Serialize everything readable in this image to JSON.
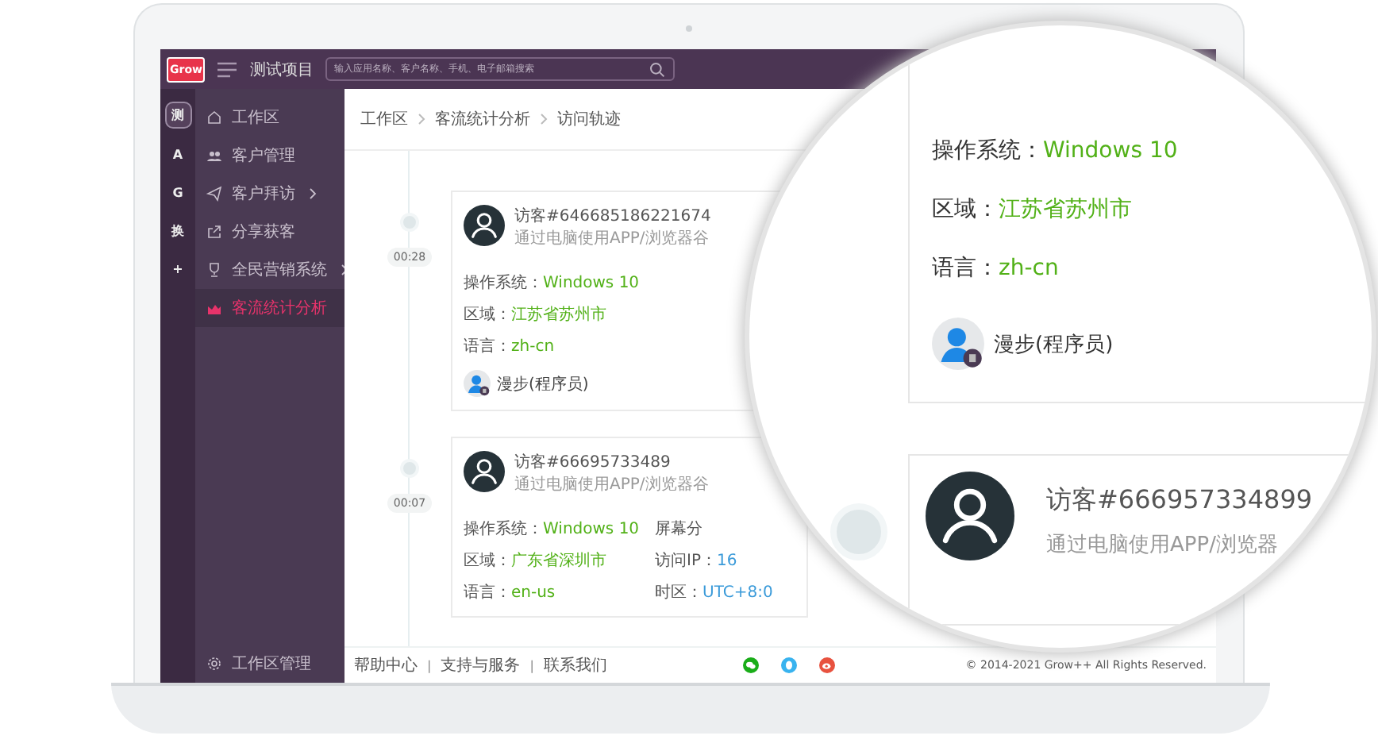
{
  "app": {
    "logo": "Grow",
    "title": "测试项目",
    "search": {
      "placeholder": "输入应用名称、客户名称、手机、电子邮箱搜索"
    }
  },
  "rail": [
    {
      "label": "测",
      "selected": true
    },
    {
      "label": "A",
      "selected": false
    },
    {
      "label": "G",
      "selected": false
    },
    {
      "label": "换",
      "selected": false
    },
    {
      "label": "+",
      "selected": false
    }
  ],
  "nav": [
    {
      "label": "工作区",
      "expandable": false,
      "selected": false
    },
    {
      "label": "客户管理",
      "expandable": false,
      "selected": false
    },
    {
      "label": "客户拜访",
      "expandable": true,
      "selected": false
    },
    {
      "label": "分享获客",
      "expandable": false,
      "selected": false
    },
    {
      "label": "全民营销系统",
      "expandable": true,
      "selected": false
    },
    {
      "label": "客流统计分析",
      "expandable": false,
      "selected": true
    }
  ],
  "nav_footer": {
    "label": "工作区管理"
  },
  "breadcrumb": [
    "工作区",
    "客流统计分析",
    "访问轨迹"
  ],
  "visits": [
    {
      "time": "00:28",
      "title": "访客#646685186221674",
      "subtitle": "通过电脑使用APP/浏览器谷",
      "fields": [
        {
          "label": "操作系统：",
          "value": "Windows 10"
        },
        {
          "label": "区域：",
          "value": "江苏省苏州市"
        },
        {
          "label": "语言：",
          "value": "zh-cn"
        }
      ],
      "user": "漫步(程序员)"
    },
    {
      "time": "00:07",
      "title": "访客#66695733489",
      "subtitle": "通过电脑使用APP/浏览器谷",
      "fields": [
        {
          "label": "操作系统：",
          "value": "Windows 10"
        },
        {
          "label": "区域：",
          "value": "广东省深圳市"
        },
        {
          "label": "语言：",
          "value": "en-us"
        }
      ],
      "extras": [
        {
          "label": "屏幕分"
        },
        {
          "label": "访问IP：",
          "value": "16"
        },
        {
          "label": "时区：",
          "value": "UTC+8:0"
        }
      ]
    }
  ],
  "footer": {
    "links": [
      "帮助中心",
      "支持与服务",
      "联系我们"
    ],
    "separator": "|",
    "socials": [
      {
        "kind": "wechat"
      },
      {
        "kind": "qq"
      },
      {
        "kind": "weibo"
      }
    ],
    "copyright": "© 2014-2021 Grow++ All Rights Reserved."
  },
  "magnifier": {
    "fields": [
      {
        "label": "操作系统：",
        "value": "Windows 10"
      },
      {
        "label": "区域：",
        "value": "江苏省苏州市"
      },
      {
        "label": "语言：",
        "value": "zh-cn"
      }
    ],
    "user": "漫步(程序员)",
    "visit": {
      "title": "访客#666957334899",
      "subtitle": "通过电脑使用APP/浏览器"
    }
  }
}
